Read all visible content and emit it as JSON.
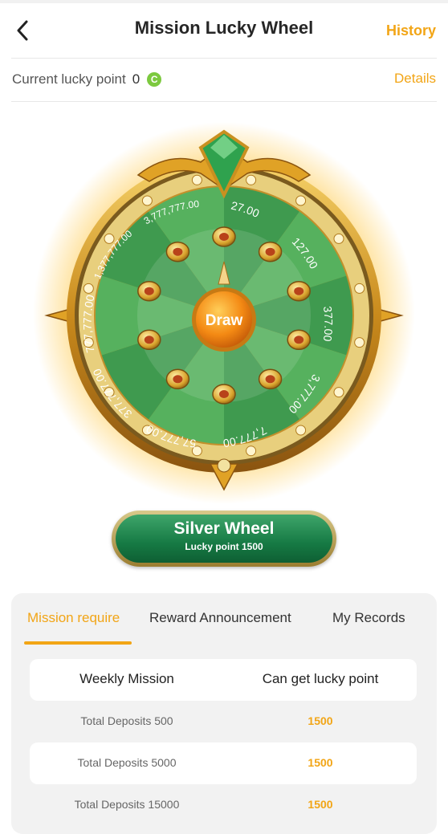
{
  "header": {
    "title": "Mission Lucky Wheel",
    "history_label": "History"
  },
  "lucky": {
    "label": "Current lucky point",
    "value": "0",
    "coin_glyph": "C",
    "details_label": "Details"
  },
  "wheel": {
    "draw_label": "Draw",
    "prizes": [
      "27.00",
      "127.00",
      "377.00",
      "3,777.00",
      "7,777.00",
      "57,777.00",
      "377,777.00",
      "777,777.00",
      "1,377,777.00",
      "3,777,777.00"
    ]
  },
  "silver_wheel": {
    "title": "Silver Wheel",
    "subtitle": "Lucky point 1500"
  },
  "tabs": [
    "Mission require",
    "Reward Announcement",
    "My Records"
  ],
  "table": {
    "headers": [
      "Weekly Mission",
      "Can get lucky point"
    ],
    "rows": [
      {
        "mission": "Total Deposits 500",
        "points": "1500"
      },
      {
        "mission": "Total Deposits 5000",
        "points": "1500"
      },
      {
        "mission": "Total Deposits 15000",
        "points": "1500"
      }
    ]
  },
  "colors": {
    "accent": "#f2a516",
    "wheel_green": "#3f9a4f",
    "button_green": "#167a44"
  }
}
